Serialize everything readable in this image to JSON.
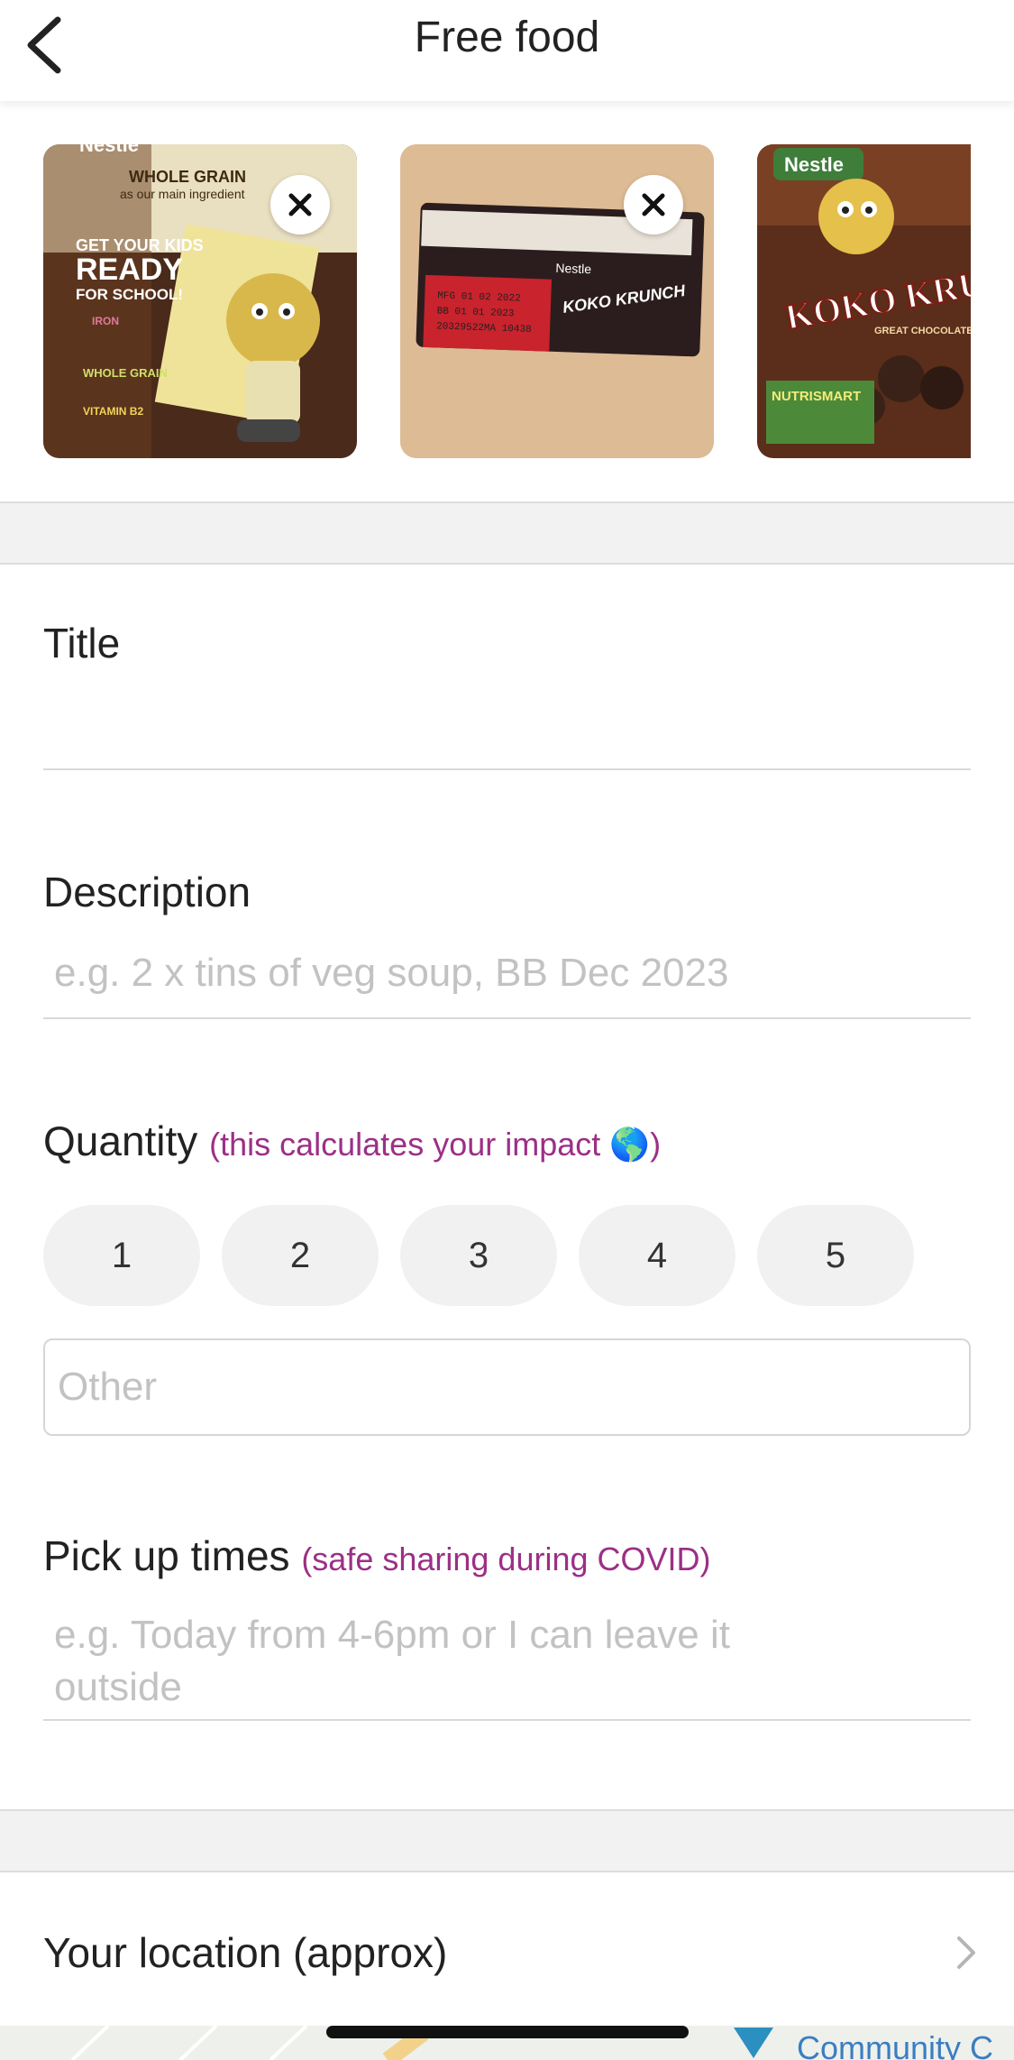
{
  "header": {
    "title": "Free food",
    "back_icon": "chevron-left-icon"
  },
  "photos": [
    {
      "description": "Nestle cereal box back panel",
      "removable": true
    },
    {
      "description": "Koko Krunch box expiry date",
      "removable": true
    },
    {
      "description": "Koko Krunch cereal box front",
      "removable": false
    }
  ],
  "photo_texts": {
    "p1_brand": "Nestle",
    "p1_heading": "WHOLE GRAIN",
    "p1_sub": "as our main ingredient",
    "p1_big1": "GET YOUR KIDS",
    "p1_big2": "READY",
    "p1_big3": "FOR SCHOOL!",
    "p1_iron": "IRON",
    "p1_grain": "WHOLE GRAIN",
    "p1_vit": "VITAMIN B2",
    "p2_mfg": "MFG 01 02 2022",
    "p2_bb": "BB  01 01 2023",
    "p2_code": "20329522MA 10438",
    "p2_brand": "Nestle",
    "p2_product": "KOKO KRUNCH",
    "p3_brand": "Nestle",
    "p3_product": "KOKO KRUNC",
    "p3_tag": "GREAT CHOCOLATEY TAS",
    "p3_badge": "NUTRISMART"
  },
  "form": {
    "title": {
      "label": "Title",
      "value": "",
      "placeholder": ""
    },
    "description": {
      "label": "Description",
      "value": "",
      "placeholder": "e.g. 2 x tins of veg soup, BB Dec 2023"
    },
    "quantity": {
      "label": "Quantity",
      "hint": "(this calculates your impact 🌎)",
      "options": [
        "1",
        "2",
        "3",
        "4",
        "5"
      ],
      "other_placeholder": "Other"
    },
    "pickup": {
      "label": "Pick up times",
      "hint": "(safe sharing during COVID)",
      "placeholder": "e.g. Today from 4-6pm or I can leave it outside"
    }
  },
  "location": {
    "label": "Your location (approx)",
    "chevron_icon": "chevron-right-icon"
  },
  "map": {
    "label": "Community C"
  }
}
